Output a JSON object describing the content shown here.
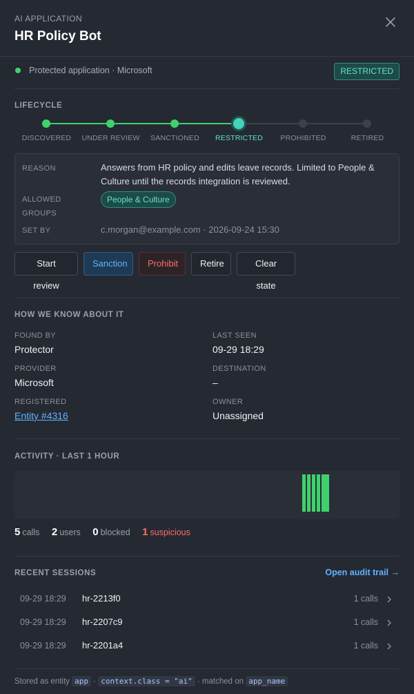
{
  "header": {
    "kicker": "AI APPLICATION",
    "title": "HR Policy Bot",
    "close_icon": "close-icon"
  },
  "status": {
    "text": "Protected application · Microsoft",
    "badge": "RESTRICTED",
    "dot_color": "#3fd26b"
  },
  "lifecycle": {
    "title": "LIFECYCLE",
    "steps": [
      {
        "label": "DISCOVERED",
        "state": "done"
      },
      {
        "label": "UNDER REVIEW",
        "state": "done"
      },
      {
        "label": "SANCTIONED",
        "state": "done"
      },
      {
        "label": "RESTRICTED",
        "state": "current"
      },
      {
        "label": "PROHIBITED",
        "state": "pending"
      },
      {
        "label": "RETIRED",
        "state": "pending"
      }
    ],
    "reason_label": "REASON",
    "reason": "Answers from HR policy and edits leave records. Limited to People & Culture until the records integration is reviewed.",
    "groups_label_1": "ALLOWED",
    "groups_label_2": "GROUPS",
    "group_chip": "People & Culture",
    "set_by_label": "SET BY",
    "set_by": "c.morgan@example.com · 2026-09-24 15:30"
  },
  "actions": {
    "start_review": "Start review",
    "sanction": "Sanction",
    "prohibit": "Prohibit",
    "retire": "Retire",
    "clear_state": "Clear state"
  },
  "how": {
    "title": "HOW WE KNOW ABOUT IT",
    "found_by_label": "FOUND BY",
    "found_by": "Protector",
    "last_seen_label": "LAST SEEN",
    "last_seen": "09-29 18:29",
    "provider_label": "PROVIDER",
    "provider": "Microsoft",
    "destination_label": "DESTINATION",
    "destination": "–",
    "registered_label": "REGISTERED",
    "registered": "Entity #4316",
    "owner_label": "OWNER",
    "owner": "Unassigned"
  },
  "activity": {
    "title": "ACTIVITY · LAST 1 HOUR",
    "bar_color": "#3fd26b",
    "stats": {
      "calls": "5",
      "calls_label": "calls",
      "users": "2",
      "users_label": "users",
      "blocked": "0",
      "blocked_label": "blocked",
      "suspicious": "1",
      "suspicious_label": "suspicious"
    }
  },
  "sessions": {
    "title": "RECENT SESSIONS",
    "audit_link": "Open audit trail →",
    "rows": [
      {
        "time": "09-29 18:29",
        "id": "hr-2213f0",
        "calls": "1 calls"
      },
      {
        "time": "09-29 18:29",
        "id": "hr-2207c9",
        "calls": "1 calls"
      },
      {
        "time": "09-29 18:29",
        "id": "hr-2201a4",
        "calls": "1 calls"
      }
    ]
  },
  "footer": {
    "prefix": "Stored as entity",
    "code1": "app",
    "sep1": "·",
    "code2": "context.class = \"ai\"",
    "mid": "· matched on",
    "code3": "app_name"
  }
}
